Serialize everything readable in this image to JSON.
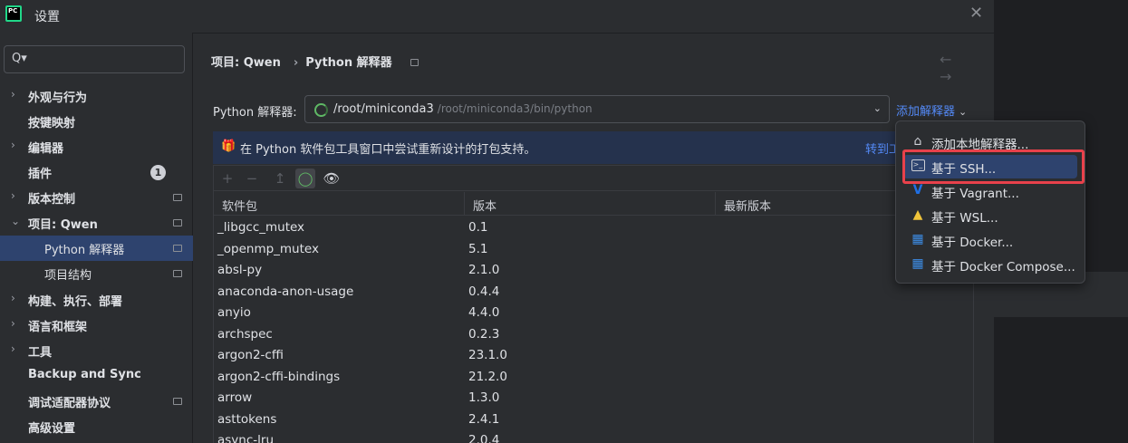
{
  "window": {
    "title": "设置"
  },
  "sidebar": {
    "search_placeholder": "",
    "items": [
      {
        "label": "外观与行为",
        "chevron": "›"
      },
      {
        "label": "按键映射"
      },
      {
        "label": "编辑器",
        "chevron": "›"
      },
      {
        "label": "插件",
        "badge": "1"
      },
      {
        "label": "版本控制",
        "chevron": "›"
      },
      {
        "label": "项目: Qwen",
        "chevron": "⌄"
      },
      {
        "label": "Python 解释器"
      },
      {
        "label": "项目结构"
      },
      {
        "label": "构建、执行、部署",
        "chevron": "›"
      },
      {
        "label": "语言和框架",
        "chevron": "›"
      },
      {
        "label": "工具",
        "chevron": "›"
      },
      {
        "label": "Backup and Sync"
      },
      {
        "label": "调试适配器协议"
      },
      {
        "label": "高级设置"
      }
    ]
  },
  "breadcrumb": {
    "project": "项目: Qwen",
    "sep": "›",
    "page": "Python 解释器"
  },
  "nav_arrows": "← →",
  "interpreter": {
    "label": "Python 解释器:",
    "name": "/root/miniconda3",
    "path": "/root/miniconda3/bin/python",
    "add_label": "添加解释器",
    "add_caret": "⌄"
  },
  "banner": {
    "text": "在 Python 软件包工具窗口中尝试重新设计的打包支持。",
    "link": "转到工"
  },
  "table": {
    "columns": [
      "软件包",
      "版本",
      "最新版本"
    ],
    "rows": [
      [
        "_libgcc_mutex",
        "0.1"
      ],
      [
        "_openmp_mutex",
        "5.1"
      ],
      [
        "absl-py",
        "2.1.0"
      ],
      [
        "anaconda-anon-usage",
        "0.4.4"
      ],
      [
        "anyio",
        "4.4.0"
      ],
      [
        "archspec",
        "0.2.3"
      ],
      [
        "argon2-cffi",
        "23.1.0"
      ],
      [
        "argon2-cffi-bindings",
        "21.2.0"
      ],
      [
        "arrow",
        "1.3.0"
      ],
      [
        "asttokens",
        "2.4.1"
      ],
      [
        "async-lru",
        "2.0.4"
      ]
    ]
  },
  "popup": {
    "items": [
      {
        "icon": "home-icon",
        "label": "添加本地解释器..."
      },
      {
        "icon": "terminal-icon",
        "label": "基于 SSH..."
      },
      {
        "icon": "vagrant-icon",
        "label": "基于 Vagrant..."
      },
      {
        "icon": "linux-icon",
        "label": "基于 WSL..."
      },
      {
        "icon": "docker-icon",
        "label": "基于 Docker..."
      },
      {
        "icon": "docker-compose-icon",
        "label": "基于 Docker Compose..."
      }
    ]
  },
  "colors": {
    "accent": "#548af7",
    "selection": "#2e436e",
    "highlight_box": "#e8414b"
  }
}
